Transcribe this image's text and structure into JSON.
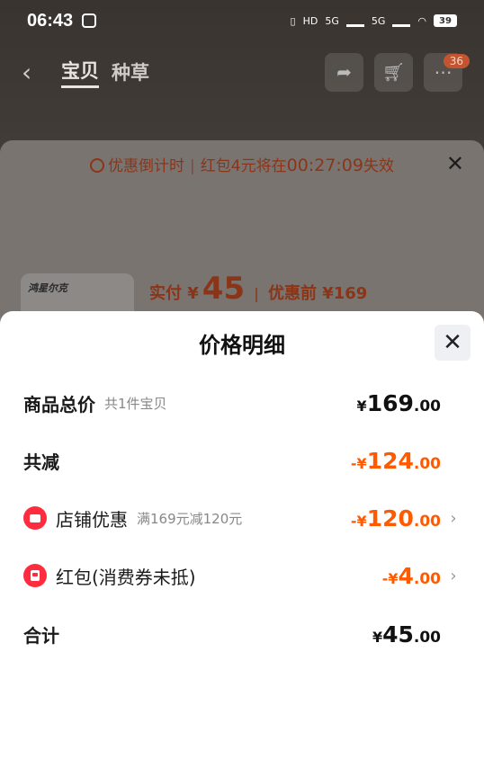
{
  "status_bar": {
    "time": "06:43",
    "net1": "5G",
    "net2": "5G",
    "hd": "HD",
    "battery": "39"
  },
  "nav": {
    "back_icon": "back-arrow-icon",
    "tabs": [
      "宝贝",
      "种草"
    ],
    "active_tab": "宝贝",
    "cart_badge": "36"
  },
  "order_sheet": {
    "countdown_label": "优惠倒计时",
    "countdown_text": "红包4元将在",
    "countdown_timer": "00:27:09",
    "countdown_suffix": "失效",
    "thumb_logo": "鸿星尔克",
    "paid_label": "实付 ¥",
    "paid_value": "45",
    "before_label": "优惠前 ¥169"
  },
  "detail": {
    "title": "价格明细",
    "rows": [
      {
        "label": "商品总价",
        "sub": "共1件宝贝",
        "currency": "¥",
        "int": "169",
        "dec": ".00"
      },
      {
        "label": "共减",
        "sub": "",
        "currency": "-¥",
        "int": "124",
        "dec": ".00"
      },
      {
        "label": "店铺优惠",
        "sub": "满169元减120元",
        "currency": "-¥",
        "int": "120",
        "dec": ".00"
      },
      {
        "label": "红包(消费券未抵)",
        "sub": "",
        "currency": "-¥",
        "int": "4",
        "dec": ".00"
      },
      {
        "label": "合计",
        "sub": "",
        "currency": "¥",
        "int": "45",
        "dec": ".00"
      }
    ]
  },
  "colors": {
    "accent_orange": "#ff5a00",
    "icon_red": "#ff2c3f"
  }
}
